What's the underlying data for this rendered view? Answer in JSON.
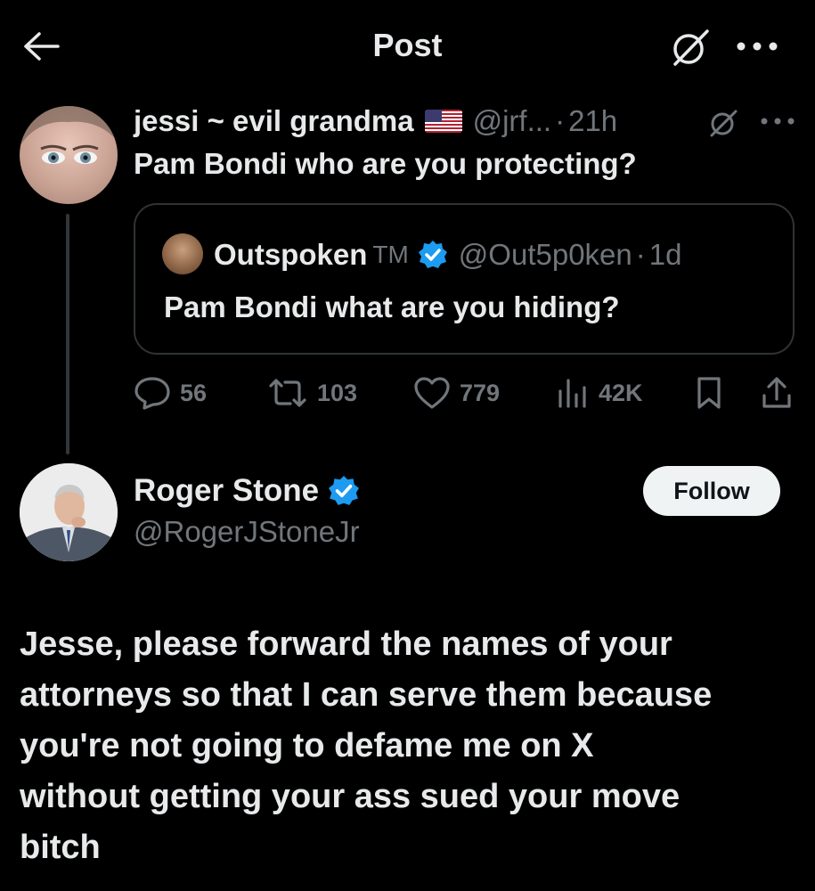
{
  "header": {
    "title": "Post",
    "back_icon": "arrow-left-icon",
    "grok_icon": "grok-icon",
    "more_icon": "more-horizontal-icon"
  },
  "tweet1": {
    "display_name": "jessi ~ evil grandma",
    "flag_icon": "us-flag-icon",
    "handle": "@jrf...",
    "separator": "·",
    "time": "21h",
    "text": "Pam Bondi who are you protecting?",
    "quote": {
      "display_name": "Outspoken",
      "tm": "TM",
      "handle": "@Out5p0ken",
      "separator": "·",
      "time": "1d",
      "text": "Pam Bondi what are you hiding?"
    },
    "actions": {
      "replies": "56",
      "reposts": "103",
      "likes": "779",
      "views": "42K"
    }
  },
  "tweet2": {
    "display_name": "Roger Stone",
    "handle": "@RogerJStoneJr",
    "follow_label": "Follow",
    "text_lines": [
      "Jesse, please forward the names of your",
      "attorneys so that I can serve them because",
      "you're not going to defame me on X",
      "without getting your ass sued your move",
      "bitch"
    ]
  },
  "colors": {
    "background": "#000000",
    "text": "#e7e9ea",
    "muted": "#71767b",
    "verified": "#1d9bf0",
    "border": "#2f3336"
  }
}
